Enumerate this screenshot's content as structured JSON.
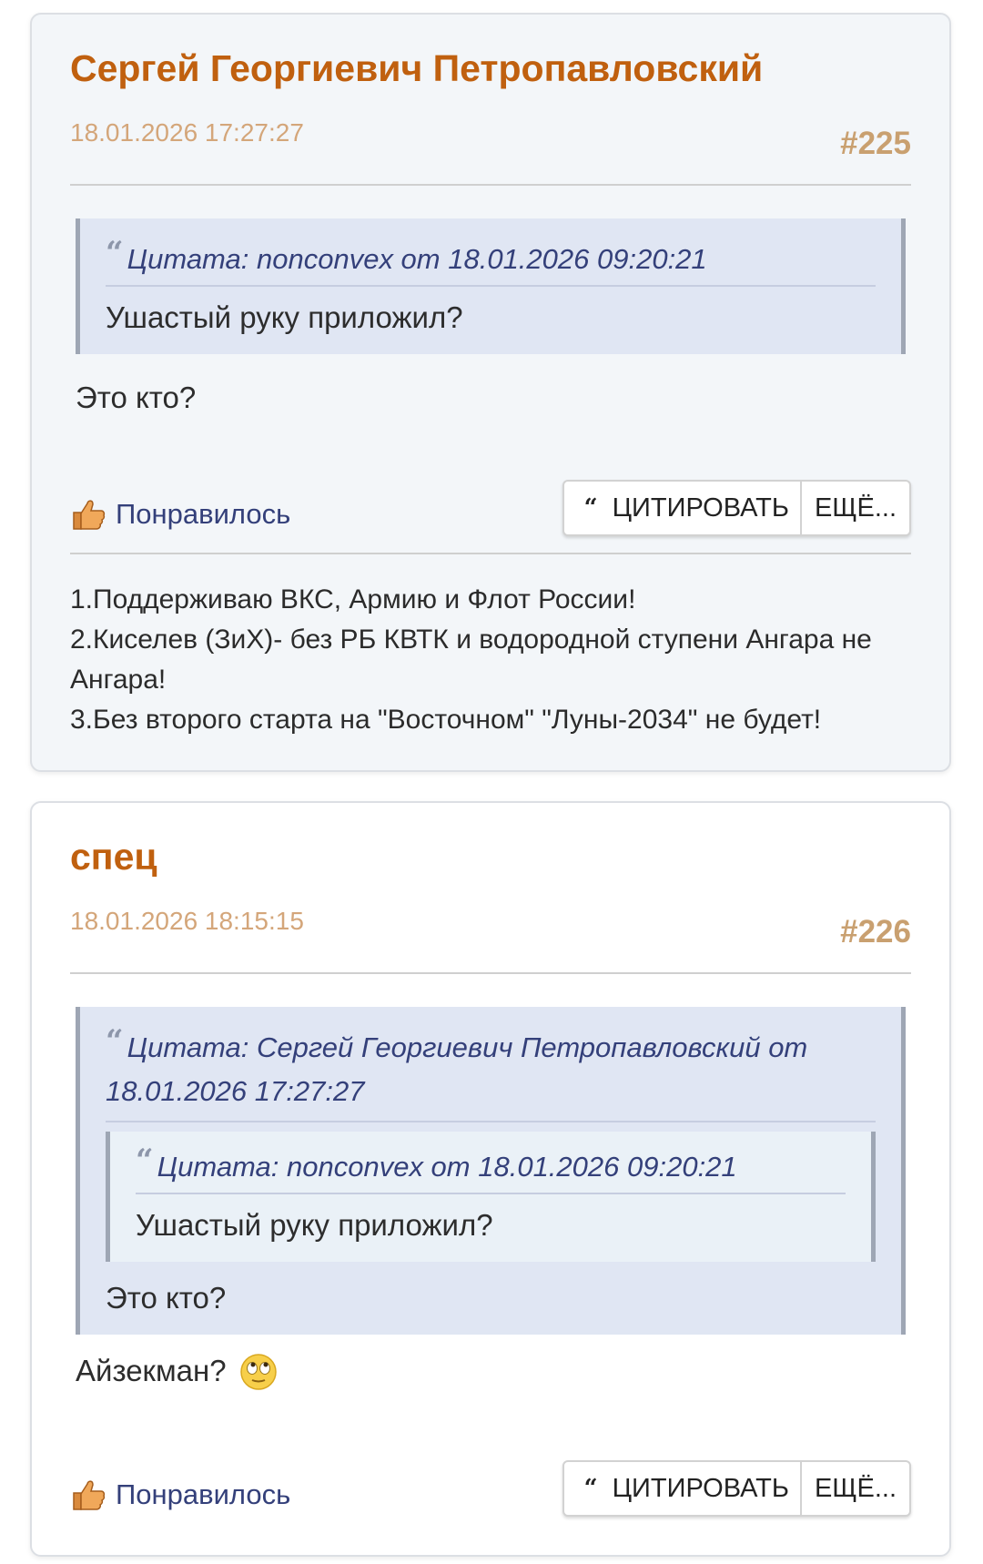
{
  "posts": [
    {
      "author": "Сергей Георгиевич Петропавловский",
      "date": "18.01.2026 17:27:27",
      "number": "#225",
      "quote": {
        "header": "Цитата: nonconvex от 18.01.2026 09:20:21",
        "body": "Ушастый руку приложил?"
      },
      "message": "Это кто?",
      "like_label": "Понравилось",
      "quote_button": "ЦИТИРОВАТЬ",
      "more_button": "ЕЩЁ...",
      "signature": [
        "1.Поддерживаю ВКС, Армию и Флот России!",
        "2.Киселев (ЗиХ)- без РБ КВТК и водородной ступени Ангара не",
        "Ангара!",
        "3.Без второго старта на \"Восточном\" \"Луны-2034\"  не будет!"
      ]
    },
    {
      "author": "спец",
      "date": "18.01.2026 18:15:15",
      "number": "#226",
      "quote": {
        "header_line1": "Цитата: Сергей Георгиевич Петропавловский от",
        "header_line2": "18.01.2026 17:27:27",
        "nested_header": "Цитата: nonconvex от 18.01.2026 09:20:21",
        "nested_body": "Ушастый руку приложил?",
        "body": "Это кто?"
      },
      "message": "Айзекман?",
      "emoji": "rolling-eyes-emoji",
      "like_label": "Понравилось",
      "quote_button": "ЦИТИРОВАТЬ",
      "more_button": "ЕЩЁ..."
    }
  ],
  "colors": {
    "author": "#c0600f",
    "date": "#d4a67a",
    "post_number": "#c9a070",
    "quote_background": "#e0e6f3",
    "link": "#34407a"
  }
}
